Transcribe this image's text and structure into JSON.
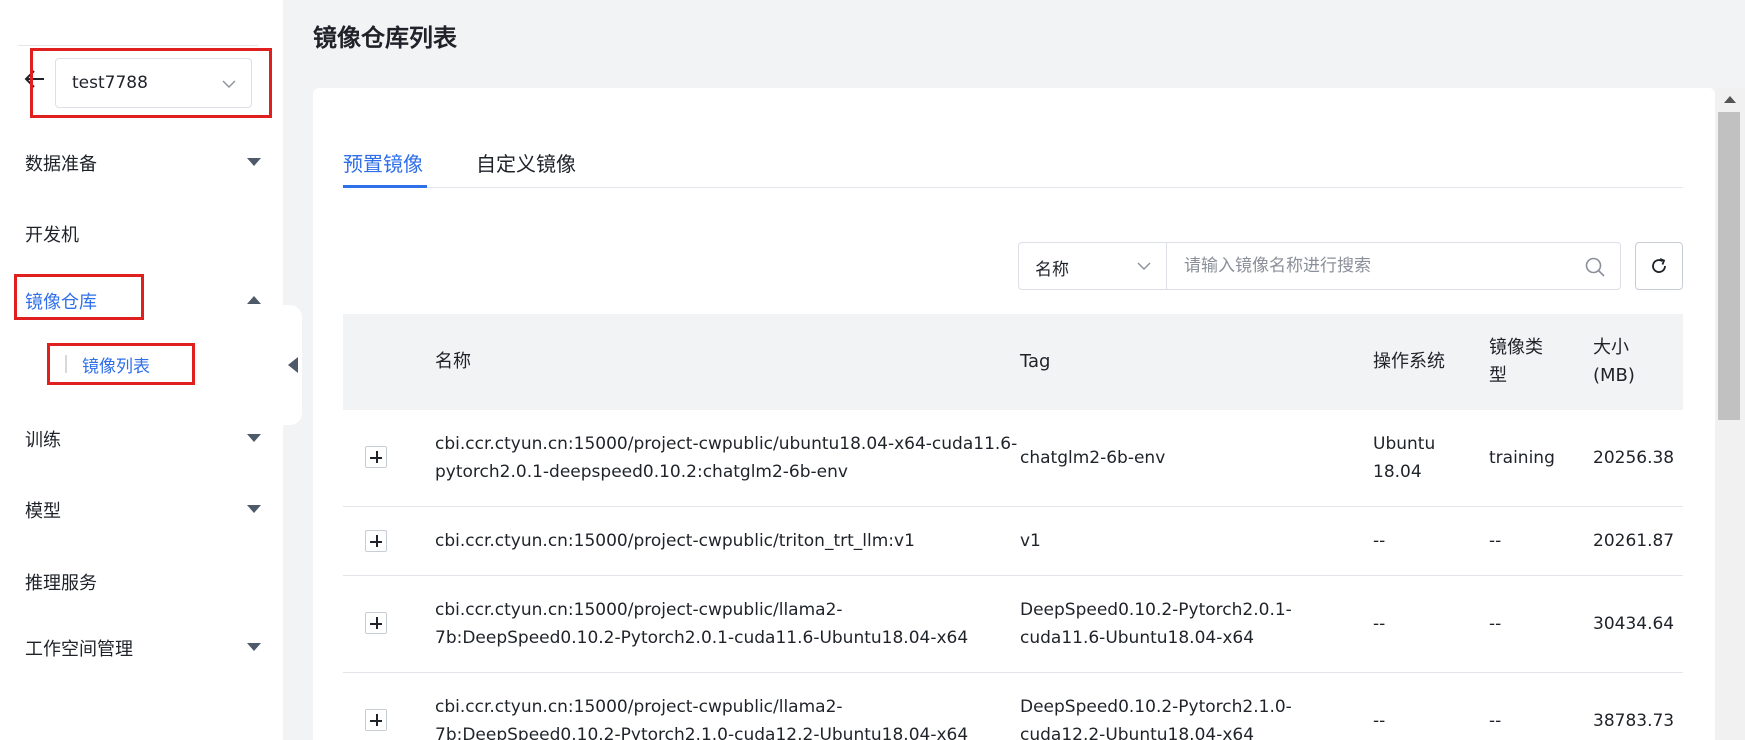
{
  "sidebar": {
    "workspace": {
      "selected": "test7788"
    },
    "items": [
      {
        "label": "数据准备"
      },
      {
        "label": "开发机"
      },
      {
        "label": "镜像仓库"
      },
      {
        "label": "训练"
      },
      {
        "label": "模型"
      },
      {
        "label": "推理服务"
      },
      {
        "label": "工作空间管理"
      }
    ],
    "sub_items": [
      {
        "label": "镜像列表"
      }
    ]
  },
  "page": {
    "title": "镜像仓库列表"
  },
  "tabs": [
    {
      "label": "预置镜像",
      "active": true
    },
    {
      "label": "自定义镜像",
      "active": false
    }
  ],
  "search": {
    "field": "名称",
    "placeholder": "请输入镜像名称进行搜索"
  },
  "table": {
    "headers": {
      "name": "名称",
      "tag": "Tag",
      "os": "操作系统",
      "type_line1": "镜像类",
      "type_line2": "型",
      "size_line1": "大小",
      "size_line2": "(MB)"
    },
    "rows": [
      {
        "name_line1": "cbi.ccr.ctyun.cn:15000/project-cwpublic/ubuntu18.04-x64-cuda11.6-",
        "name_line2": "pytorch2.0.1-deepspeed0.10.2:chatglm2-6b-env",
        "tag_line1": "chatglm2-6b-env",
        "tag_line2": "",
        "os_line1": "Ubuntu",
        "os_line2": "18.04",
        "type": "training",
        "size": "20256.38"
      },
      {
        "name_line1": "cbi.ccr.ctyun.cn:15000/project-cwpublic/triton_trt_llm:v1",
        "name_line2": "",
        "tag_line1": "v1",
        "tag_line2": "",
        "os_line1": "--",
        "os_line2": "",
        "type": "--",
        "size": "20261.87"
      },
      {
        "name_line1": "cbi.ccr.ctyun.cn:15000/project-cwpublic/llama2-",
        "name_line2": "7b:DeepSpeed0.10.2-Pytorch2.0.1-cuda11.6-Ubuntu18.04-x64",
        "tag_line1": "DeepSpeed0.10.2-Pytorch2.0.1-",
        "tag_line2": "cuda11.6-Ubuntu18.04-x64",
        "os_line1": "--",
        "os_line2": "",
        "type": "--",
        "size": "30434.64"
      },
      {
        "name_line1": "cbi.ccr.ctyun.cn:15000/project-cwpublic/llama2-",
        "name_line2": "7b:DeepSpeed0.10.2-Pytorch2.1.0-cuda12.2-Ubuntu18.04-x64",
        "tag_line1": "DeepSpeed0.10.2-Pytorch2.1.0-",
        "tag_line2": "cuda12.2-Ubuntu18.04-x64",
        "os_line1": "--",
        "os_line2": "",
        "type": "--",
        "size": "38783.73"
      }
    ]
  },
  "colors": {
    "accent": "#2f6fea",
    "highlight_box": "#e0201f",
    "page_bg": "#f2f3f5"
  }
}
